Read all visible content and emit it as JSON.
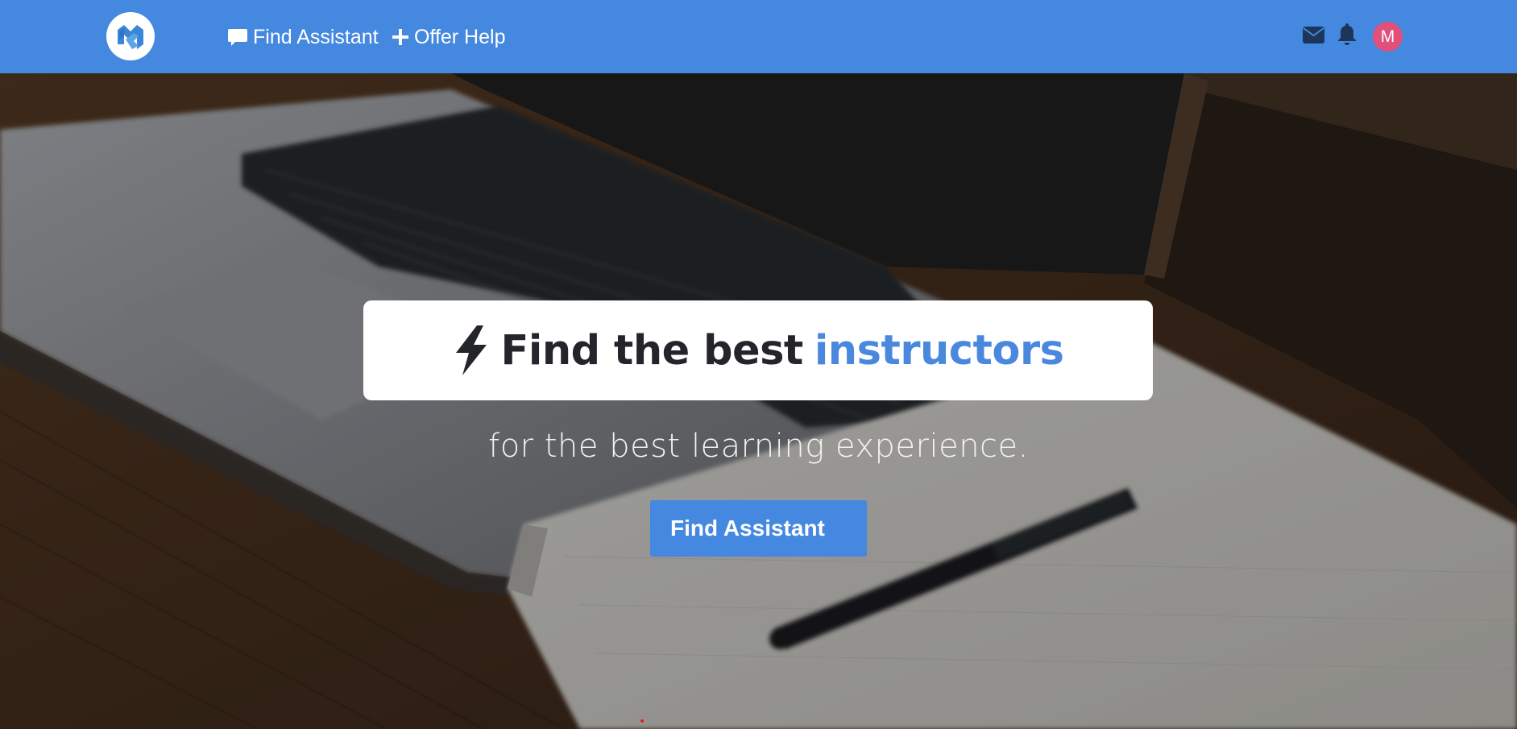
{
  "navbar": {
    "logo_icon": "brand-logo-icon",
    "links": [
      {
        "label": "Find Assistant",
        "icon": "chat-bubble-icon"
      },
      {
        "label": "Offer Help",
        "icon": "plus-icon"
      }
    ],
    "mail_icon": "envelope-icon",
    "bell_icon": "bell-icon",
    "avatar_initial": "M",
    "avatar_color": "#e0507a",
    "bar_color": "#4488e0"
  },
  "hero": {
    "headline_prefix": "Find the best",
    "headline_accent": "instructors",
    "headline_icon": "lightning-bolt-icon",
    "accent_color": "#4a88dd",
    "tagline": "for the best learning experience.",
    "cta_label": "Find Assistant",
    "background": "laptop-notebook-pen-photo"
  }
}
